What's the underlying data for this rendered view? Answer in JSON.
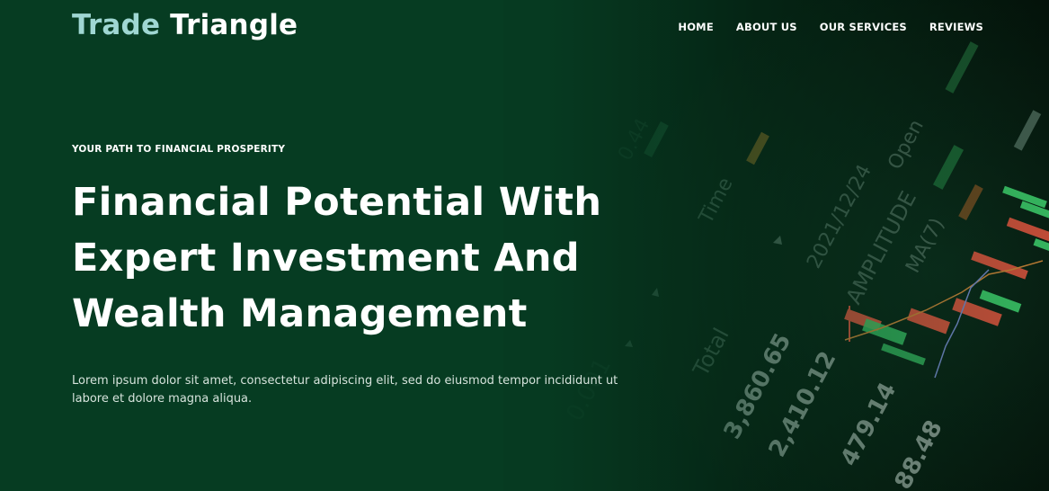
{
  "brand": {
    "part1": "Trade",
    "part2": "Triangle"
  },
  "nav": {
    "items": [
      {
        "label": "HOME"
      },
      {
        "label": "ABOUT US"
      },
      {
        "label": "OUR SERVICES"
      },
      {
        "label": "REVIEWS"
      }
    ]
  },
  "hero": {
    "eyebrow": "YOUR PATH TO FINANCIAL PROSPERITY",
    "headline_lines": [
      "Financial Potential With",
      "Expert Investment And",
      "Wealth Management"
    ],
    "description": "Lorem ipsum dolor sit amet, consectetur adipiscing elit, sed do eiusmod tempor incididunt ut labore et dolore magna aliqua.",
    "background_image": {
      "labels": [
        "Total",
        "Time",
        "AMPLITUDE",
        "MA(7)",
        "Open",
        "3,860.65",
        "2,410.12",
        "479.14",
        "88.48",
        "2021/12/24"
      ]
    }
  },
  "colors": {
    "background": "#063c22",
    "brand_accent": "#9fd7d3",
    "text": "#ffffff",
    "candle_up": "#3ecf6c",
    "candle_down": "#e0553f"
  }
}
